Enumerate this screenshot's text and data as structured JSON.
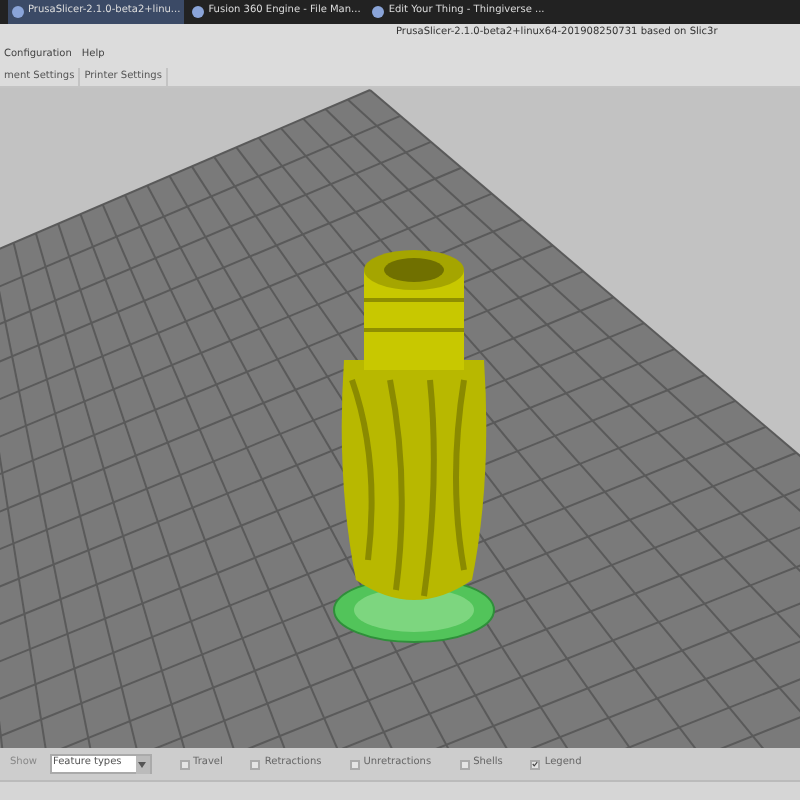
{
  "taskbar": {
    "items": [
      {
        "label": "PrusaSlicer-2.1.0-beta2+linu...",
        "selected": true
      },
      {
        "label": "Fusion 360 Engine - File Man...",
        "selected": false
      },
      {
        "label": "Edit Your Thing - Thingiverse ...",
        "selected": false
      }
    ]
  },
  "window": {
    "title": "PrusaSlicer-2.1.0-beta2+linux64-201908250731 based on Slic3r"
  },
  "menu": [
    "Configuration",
    "Help"
  ],
  "tabs": [
    {
      "label": "ment Settings",
      "selected": false
    },
    {
      "label": "Printer Settings",
      "selected": false
    }
  ],
  "bottom_bar": {
    "show_label": "Show",
    "view_select": "Feature types",
    "options": [
      {
        "label": "Travel",
        "checked": false
      },
      {
        "label": "Retractions",
        "checked": false
      },
      {
        "label": "Unretractions",
        "checked": false
      },
      {
        "label": "Shells",
        "checked": false
      },
      {
        "label": "Legend",
        "checked": true
      }
    ]
  }
}
